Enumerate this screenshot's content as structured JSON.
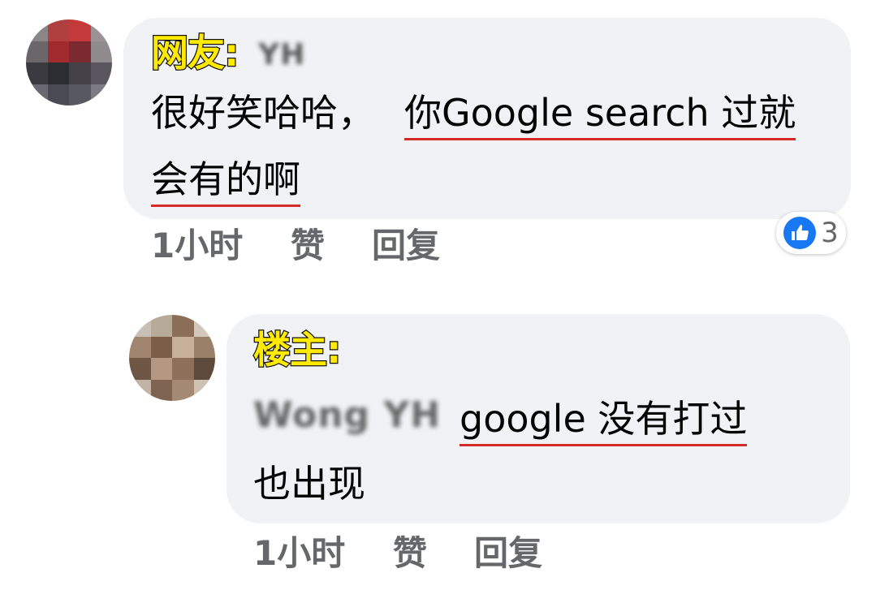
{
  "comments": [
    {
      "tag": "网友:",
      "blurred_name": "YH",
      "text_line1_plain": "很好笑哈哈，",
      "text_line1_underlined": "你Google search 过就",
      "text_line2_underlined": "会有的啊",
      "time": "1小时",
      "like": "赞",
      "reply": "回复",
      "reaction_count": "3"
    },
    {
      "tag": "楼主:",
      "blurred_name": "Wong YH",
      "text_line1_underlined": "google 没有打过",
      "text_line2": "也出现",
      "time": "1小时",
      "like": "赞",
      "reply": "回复"
    }
  ],
  "colors": {
    "bubble": "#f0f2f5",
    "tag_fill": "#ffea00",
    "underline": "#d42a2a",
    "meta": "#65676b",
    "like_blue": "#1877f2"
  },
  "icons": [
    "like-icon"
  ]
}
